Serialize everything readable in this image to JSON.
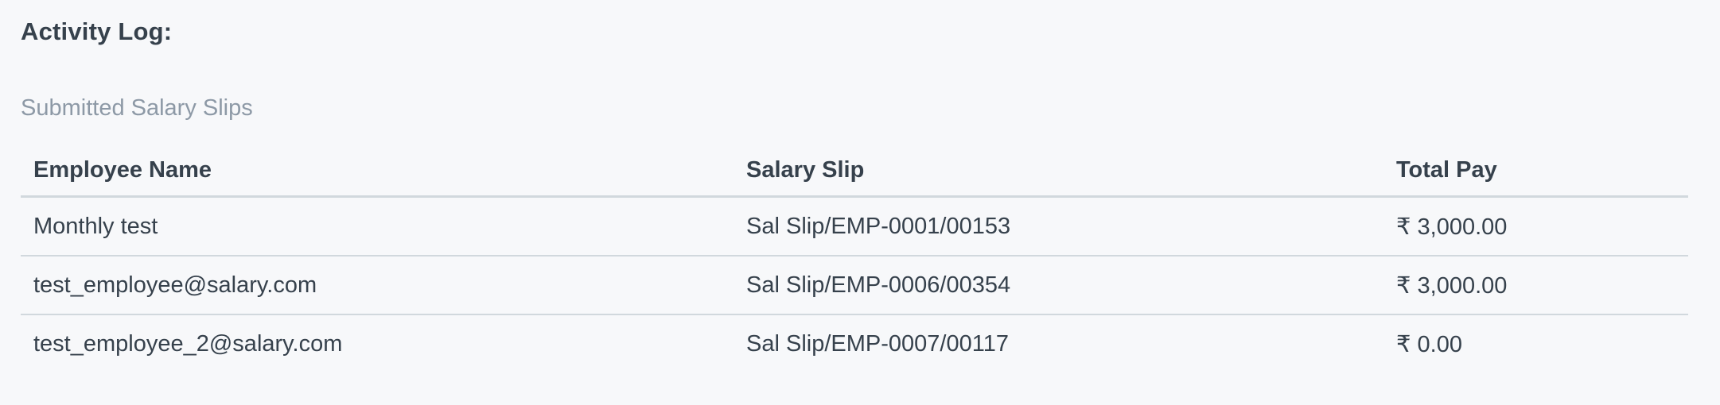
{
  "activity_log": {
    "title": "Activity Log:",
    "subtitle": "Submitted Salary Slips",
    "table": {
      "headers": [
        "Employee Name",
        "Salary Slip",
        "Total Pay"
      ],
      "rows": [
        {
          "employee_name": "Monthly test",
          "salary_slip": "Sal Slip/EMP-0001/00153",
          "total_pay": "₹ 3,000.00"
        },
        {
          "employee_name": "test_employee@salary.com",
          "salary_slip": "Sal Slip/EMP-0006/00354",
          "total_pay": "₹ 3,000.00"
        },
        {
          "employee_name": "test_employee_2@salary.com",
          "salary_slip": "Sal Slip/EMP-0007/00117",
          "total_pay": "₹ 0.00"
        }
      ]
    }
  },
  "colors": {
    "background": "#f7f8fa",
    "text": "#36414c",
    "muted_text": "#8d99a6",
    "border": "#d1d8dd"
  }
}
